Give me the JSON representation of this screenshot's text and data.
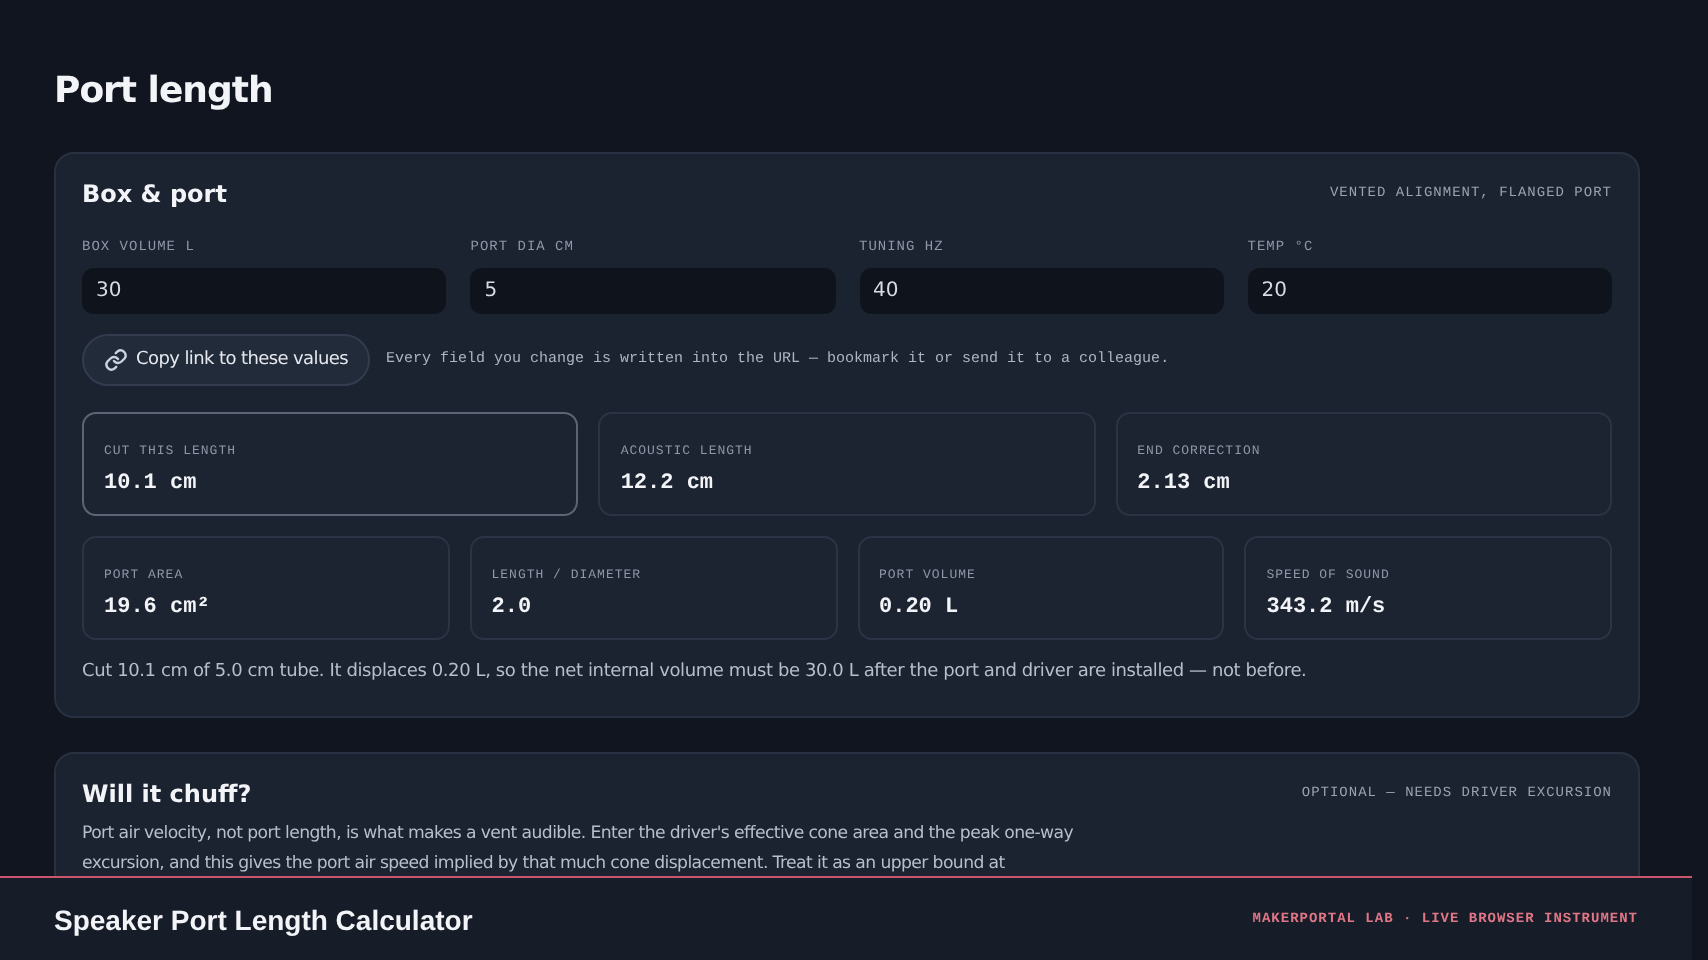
{
  "page_title": "Port length",
  "box_port": {
    "title": "Box & port",
    "tag": "VENTED ALIGNMENT, FLANGED PORT",
    "fields": [
      {
        "label": "BOX VOLUME L",
        "value": "30"
      },
      {
        "label": "PORT DIA CM",
        "value": "5"
      },
      {
        "label": "TUNING HZ",
        "value": "40"
      },
      {
        "label": "TEMP °C",
        "value": "20"
      }
    ],
    "copy_button": "Copy link to these values",
    "note": "Every field you change is written into the URL — bookmark it or send it to a colleague.",
    "primary_results": [
      {
        "label": "CUT THIS LENGTH",
        "value": "10.1 cm",
        "highlighted": true
      },
      {
        "label": "ACOUSTIC LENGTH",
        "value": "12.2 cm",
        "highlighted": false
      },
      {
        "label": "END CORRECTION",
        "value": "2.13 cm",
        "highlighted": false
      }
    ],
    "secondary_results": [
      {
        "label": "PORT AREA",
        "value": "19.6 cm²"
      },
      {
        "label": "LENGTH / DIAMETER",
        "value": "2.0"
      },
      {
        "label": "PORT VOLUME",
        "value": "0.20 L"
      },
      {
        "label": "SPEED OF SOUND",
        "value": "343.2 m/s"
      }
    ],
    "summary": "Cut 10.1 cm of 5.0 cm tube. It displaces 0.20 L, so the net internal volume must be 30.0 L after the port and driver are installed — not before."
  },
  "chuff": {
    "title": "Will it chuff?",
    "tag": "OPTIONAL — NEEDS DRIVER EXCURSION",
    "text": "Port air velocity, not port length, is what makes a vent audible. Enter the driver's effective cone area and the peak one-way excursion, and this gives the port air speed implied by that much cone displacement. Treat it as an upper bound at"
  },
  "footer": {
    "title": "Speaker Port Length Calculator",
    "brand": "MAKERPORTAL LAB · LIVE BROWSER INSTRUMENT"
  }
}
